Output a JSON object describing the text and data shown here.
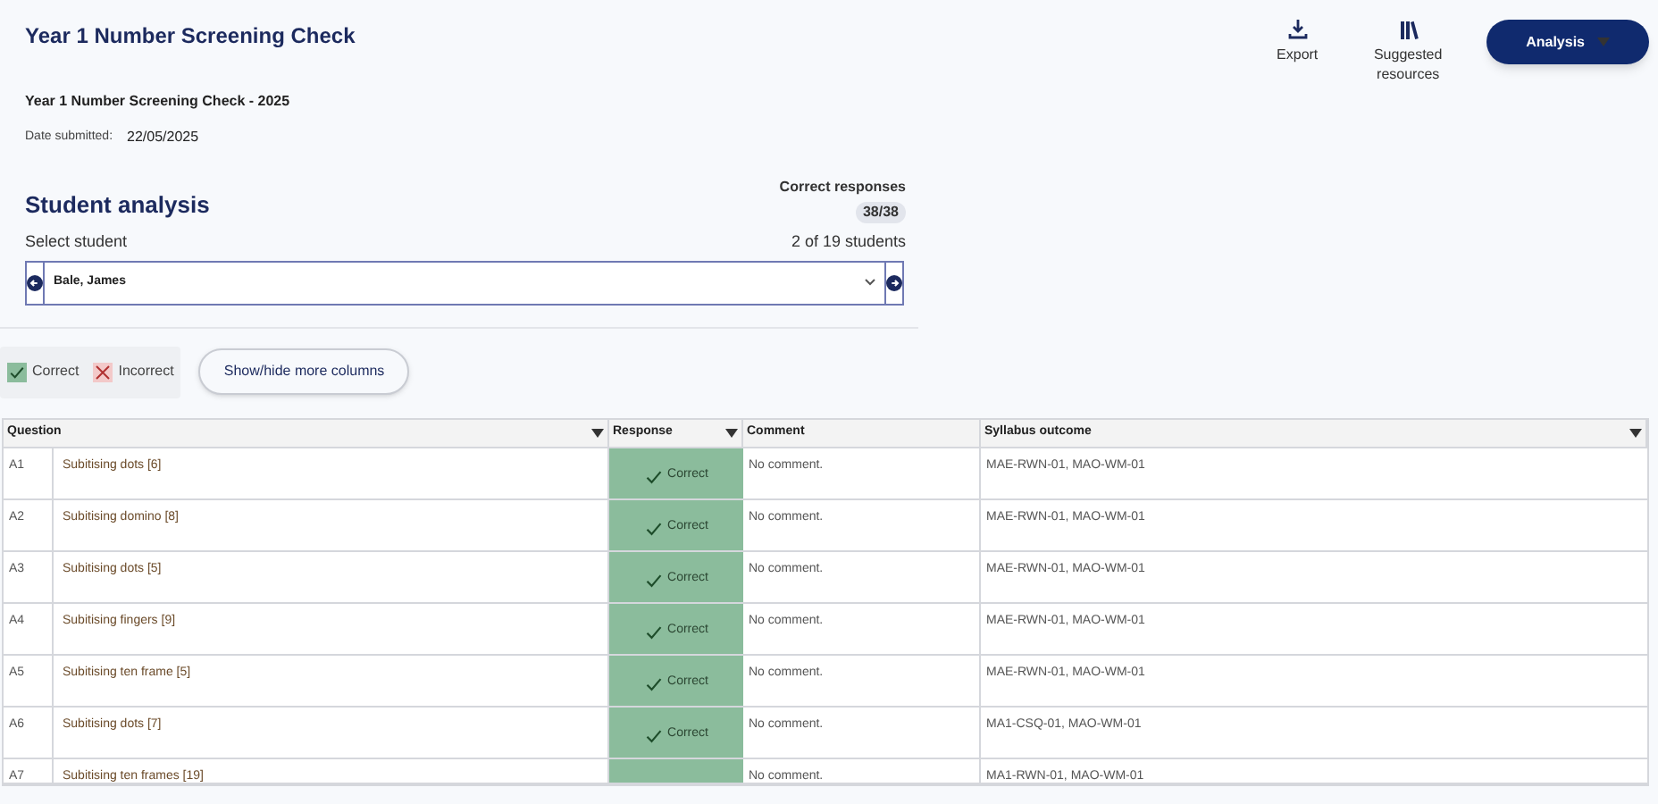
{
  "header": {
    "title": "Year 1 Number Screening Check",
    "actions": [
      {
        "kind": "export",
        "label": "Export"
      },
      {
        "kind": "resources",
        "label": "Suggested resources"
      }
    ],
    "menu_button": "Analysis"
  },
  "assessment": {
    "name": "Year 1 Number Screening Check - 2025",
    "date_label": "Date submitted:",
    "date": "22/05/2025"
  },
  "student_analysis": {
    "title": "Student analysis",
    "correct_label": "Correct responses",
    "correct_count": "38/38",
    "select_label": "Select student",
    "position": "2 of 19 students",
    "student": "Bale, James"
  },
  "legend": [
    {
      "kind": "correct",
      "label": "Correct"
    },
    {
      "kind": "incorrect",
      "label": "Incorrect"
    }
  ],
  "columns_button": "Show/hide more columns",
  "table": {
    "columns": [
      {
        "label": "Question",
        "filter": true
      },
      {
        "label": "Response",
        "filter": true
      },
      {
        "label": "Comment",
        "filter": false
      },
      {
        "label": "Syllabus outcome",
        "filter": true
      }
    ],
    "rows": [
      {
        "id": "A1",
        "question": "Subitising dots [6]",
        "kind": "correct",
        "response": "Correct",
        "comment": "No comment.",
        "outcome": "MAE-RWN-01, MAO-WM-01"
      },
      {
        "id": "A2",
        "question": "Subitising domino [8]",
        "kind": "correct",
        "response": "Correct",
        "comment": "No comment.",
        "outcome": "MAE-RWN-01, MAO-WM-01"
      },
      {
        "id": "A3",
        "question": "Subitising dots [5]",
        "kind": "correct",
        "response": "Correct",
        "comment": "No comment.",
        "outcome": "MAE-RWN-01, MAO-WM-01"
      },
      {
        "id": "A4",
        "question": "Subitising fingers [9]",
        "kind": "correct",
        "response": "Correct",
        "comment": "No comment.",
        "outcome": "MAE-RWN-01, MAO-WM-01"
      },
      {
        "id": "A5",
        "question": "Subitising ten frame [5]",
        "kind": "correct",
        "response": "Correct",
        "comment": "No comment.",
        "outcome": "MAE-RWN-01, MAO-WM-01"
      },
      {
        "id": "A6",
        "question": "Subitising dots [7]",
        "kind": "correct",
        "response": "Correct",
        "comment": "No comment.",
        "outcome": "MA1-CSQ-01, MAO-WM-01"
      },
      {
        "id": "A7",
        "question": "Subitising ten frames [19]",
        "kind": "correct",
        "comment": "No comment.",
        "outcome": "MA1-RWN-01, MAO-WM-01"
      }
    ]
  }
}
